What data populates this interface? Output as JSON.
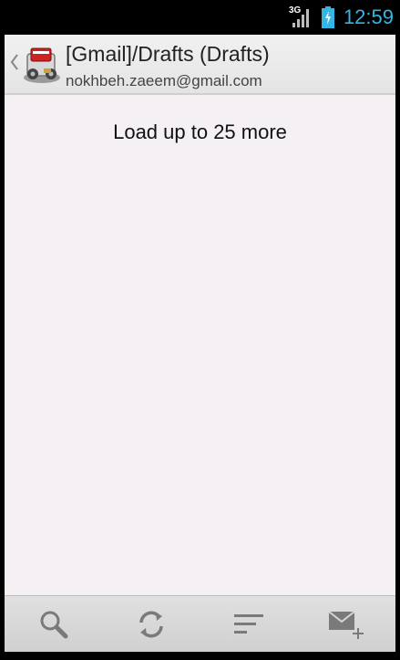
{
  "status_bar": {
    "network": "3G",
    "time": "12:59",
    "icons": [
      "signal-icon",
      "battery-charging-icon"
    ]
  },
  "action_bar": {
    "title": "[Gmail]/Drafts (Drafts)",
    "subtitle": "nokhbeh.zaeem@gmail.com",
    "icons": [
      "up-caret-icon",
      "app-icon"
    ]
  },
  "content": {
    "load_more_label": "Load up to 25 more"
  },
  "bottom_bar": {
    "actions": [
      "search-icon",
      "refresh-icon",
      "sort-icon",
      "compose-icon"
    ]
  },
  "colors": {
    "clock": "#33b5e5",
    "content_bg": "#f5f0f4",
    "bar_bg": "#e4e4e4",
    "icon_gray": "#7a7a7a"
  }
}
